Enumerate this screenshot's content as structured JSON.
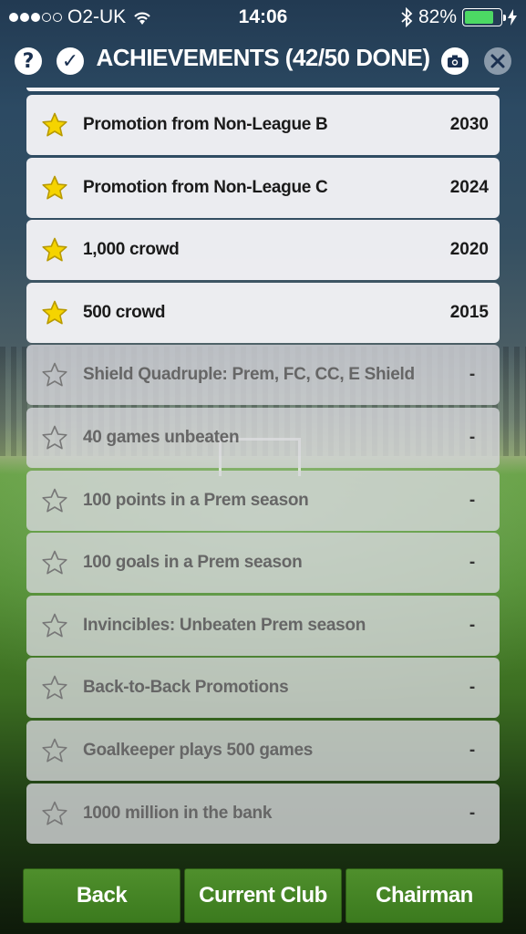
{
  "status_bar": {
    "carrier": "O2-UK",
    "time": "14:06",
    "battery": "82%",
    "battery_level": 0.82
  },
  "header": {
    "title": "ACHIEVEMENTS (42/50 DONE)"
  },
  "achievements": [
    {
      "label": "Promotion from Non-League B",
      "year": "2030",
      "done": true
    },
    {
      "label": "Promotion from Non-League C",
      "year": "2024",
      "done": true
    },
    {
      "label": "1,000 crowd",
      "year": "2020",
      "done": true
    },
    {
      "label": "500 crowd",
      "year": "2015",
      "done": true
    },
    {
      "label": "Shield Quadruple: Prem, FC, CC, E Shield",
      "year": "-",
      "done": false
    },
    {
      "label": "40 games unbeaten",
      "year": "-",
      "done": false
    },
    {
      "label": "100 points in a Prem season",
      "year": "-",
      "done": false
    },
    {
      "label": "100 goals in a Prem season",
      "year": "-",
      "done": false
    },
    {
      "label": "Invincibles: Unbeaten Prem season",
      "year": "-",
      "done": false
    },
    {
      "label": "Back-to-Back Promotions",
      "year": "-",
      "done": false
    },
    {
      "label": "Goalkeeper plays 500 games",
      "year": "-",
      "done": false
    },
    {
      "label": "1000 million in the bank",
      "year": "-",
      "done": false
    }
  ],
  "buttons": {
    "back": "Back",
    "current_club": "Current Club",
    "chairman": "Chairman"
  },
  "colors": {
    "star_filled": "#f5d400",
    "button_green": "#3b7a1e",
    "battery_green": "#4cd964"
  }
}
